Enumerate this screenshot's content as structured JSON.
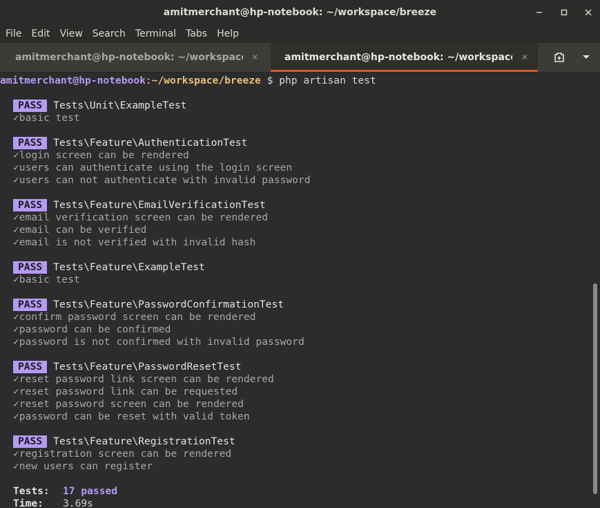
{
  "window": {
    "title": "amitmerchant@hp-notebook: ~/workspace/breeze"
  },
  "menu": [
    "File",
    "Edit",
    "View",
    "Search",
    "Terminal",
    "Tabs",
    "Help"
  ],
  "tabs": [
    {
      "label": "amitmerchant@hp-notebook: ~/workspace/...",
      "active": false
    },
    {
      "label": "amitmerchant@hp-notebook: ~/workspace/...",
      "active": true
    }
  ],
  "icons": {
    "minimize": "minimize-icon",
    "maximize": "maximize-icon",
    "close": "close-icon",
    "new_tab": "new-tab-icon",
    "tabs_menu": "chevron-down-icon"
  },
  "prompt": {
    "user": "amitmerchant@hp-notebook",
    "separator": ":",
    "path": "~/workspace/breeze",
    "symbol": "$",
    "command": "php artisan test"
  },
  "suites": [
    {
      "badge": "PASS",
      "name": "Tests\\Unit\\ExampleTest",
      "cases": [
        "basic test"
      ]
    },
    {
      "badge": "PASS",
      "name": "Tests\\Feature\\AuthenticationTest",
      "cases": [
        "login screen can be rendered",
        "users can authenticate using the login screen",
        "users can not authenticate with invalid password"
      ]
    },
    {
      "badge": "PASS",
      "name": "Tests\\Feature\\EmailVerificationTest",
      "cases": [
        "email verification screen can be rendered",
        "email can be verified",
        "email is not verified with invalid hash"
      ]
    },
    {
      "badge": "PASS",
      "name": "Tests\\Feature\\ExampleTest",
      "cases": [
        "basic test"
      ]
    },
    {
      "badge": "PASS",
      "name": "Tests\\Feature\\PasswordConfirmationTest",
      "cases": [
        "confirm password screen can be rendered",
        "password can be confirmed",
        "password is not confirmed with invalid password"
      ]
    },
    {
      "badge": "PASS",
      "name": "Tests\\Feature\\PasswordResetTest",
      "cases": [
        "reset password link screen can be rendered",
        "reset password link can be requested",
        "reset password screen can be rendered",
        "password can be reset with valid token"
      ]
    },
    {
      "badge": "PASS",
      "name": "Tests\\Feature\\RegistrationTest",
      "cases": [
        "registration screen can be rendered",
        "new users can register"
      ]
    }
  ],
  "check_mark": "✓",
  "summary": {
    "tests_label": "Tests:",
    "tests_value": "17 passed",
    "time_label": "Time:",
    "time_value": "3.69s"
  },
  "colors": {
    "accent": "#b59af5",
    "path": "#e8c07a",
    "active_tab_underline": "#e95420",
    "terminal_background": "#2c2c2c"
  }
}
